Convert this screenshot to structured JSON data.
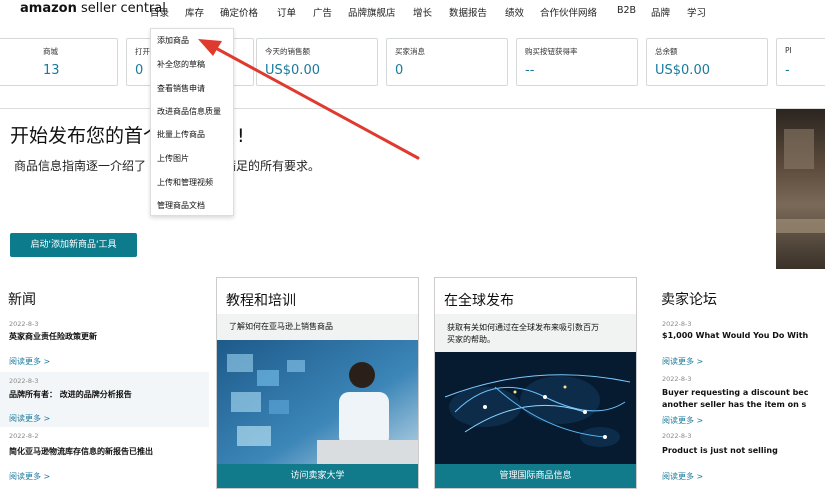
{
  "nav": {
    "logo_bold": "amazon",
    "logo_rest": " seller central",
    "items": [
      "目录",
      "库存",
      "确定价格",
      "订单",
      "广告",
      "品牌旗舰店",
      "增长",
      "数据报告",
      "绩效",
      "合作伙伴网络",
      "B2B",
      "品牌",
      "学习"
    ]
  },
  "metrics": [
    {
      "label": "商城",
      "value": "13"
    },
    {
      "label": "打开",
      "value": "0"
    },
    {
      "label": "今天的销售额",
      "value": "US$0.00"
    },
    {
      "label": "买家消息",
      "value": "0"
    },
    {
      "label": "购买按钮获得率",
      "value": "--"
    },
    {
      "label": "总余额",
      "value": "US$0.00"
    },
    {
      "label": "PI",
      "value": "-"
    }
  ],
  "hero": {
    "title": "开始发布您的首个",
    "title_tail": "!",
    "desc": "商品信息指南逐一介绍了",
    "desc_tail": "品信息时需要满足的所有要求。",
    "button": "启动'添加新商品'工具"
  },
  "menu": {
    "items": [
      "添加商品",
      "补全您的草稿",
      "查看销售申请",
      "改进商品信息质量",
      "批量上传商品",
      "上传图片",
      "上传和管理视频",
      "管理商品文档"
    ]
  },
  "news": {
    "heading": "新闻",
    "items": [
      {
        "date": "2022-8-3",
        "title": "英家商业责任险政策更新",
        "more": "阅读更多 >"
      },
      {
        "date": "2022-8-3",
        "title": "品牌所有者： 改进的品牌分析报告",
        "more": "阅读更多 >"
      },
      {
        "date": "2022-8-2",
        "title": "简化亚马逊物流库存信息的新报告已推出",
        "more": "阅读更多 >"
      }
    ]
  },
  "training": {
    "heading": "教程和培训",
    "sub": "了解如何在亚马逊上销售商品",
    "button": "访问卖家大学"
  },
  "global": {
    "heading": "在全球发布",
    "sub1": "获取有关如何通过在全球发布来吸引数百万",
    "sub2": "买家的帮助。",
    "button": "管理国际商品信息"
  },
  "forum": {
    "heading": "卖家论坛",
    "items": [
      {
        "date": "2022-8-3",
        "title": "$1,000 What Would You Do With",
        "title2": "",
        "more": "阅读更多 >"
      },
      {
        "date": "2022-8-3",
        "title": "Buyer requesting a discount bec",
        "title2": "another seller has the item on s",
        "more": "阅读更多 >"
      },
      {
        "date": "2022-8-3",
        "title": "Product is just not selling",
        "title2": "",
        "more": "阅读更多 >"
      }
    ]
  },
  "colors": {
    "accent": "#0c7c8c",
    "link": "#1a7a9c",
    "arrow": "#e03a2f"
  }
}
